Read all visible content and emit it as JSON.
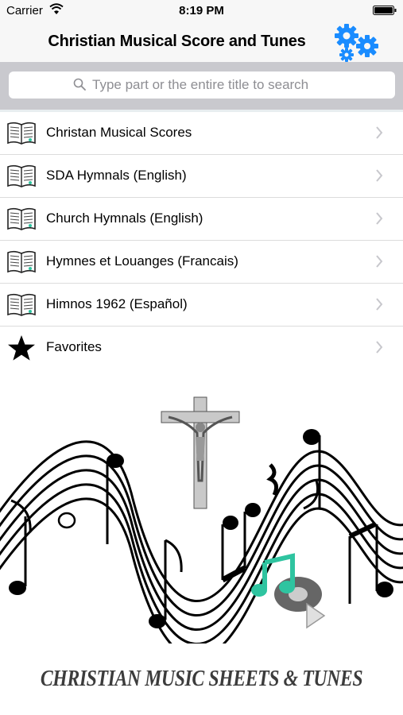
{
  "status_bar": {
    "carrier": "Carrier",
    "time": "8:19 PM"
  },
  "nav": {
    "title": "Christian Musical Score and Tunes",
    "settings_icon": "gears-icon"
  },
  "search": {
    "placeholder": "Type part or the entire title to search"
  },
  "menu": [
    {
      "label": "Christan Musical Scores",
      "icon": "book-icon"
    },
    {
      "label": "SDA Hymnals (English)",
      "icon": "book-icon"
    },
    {
      "label": "Church Hymnals (English)",
      "icon": "book-icon"
    },
    {
      "label": "Hymnes et Louanges (Francais)",
      "icon": "book-icon"
    },
    {
      "label": "Himnos 1962 (Español)",
      "icon": "book-icon"
    },
    {
      "label": "Favorites",
      "icon": "star-icon"
    }
  ],
  "footer": {
    "title": "CHRISTIAN MUSIC SHEETS  & TUNES"
  },
  "colors": {
    "accent": "#1a8cff",
    "music_note": "#2fc4a0"
  }
}
